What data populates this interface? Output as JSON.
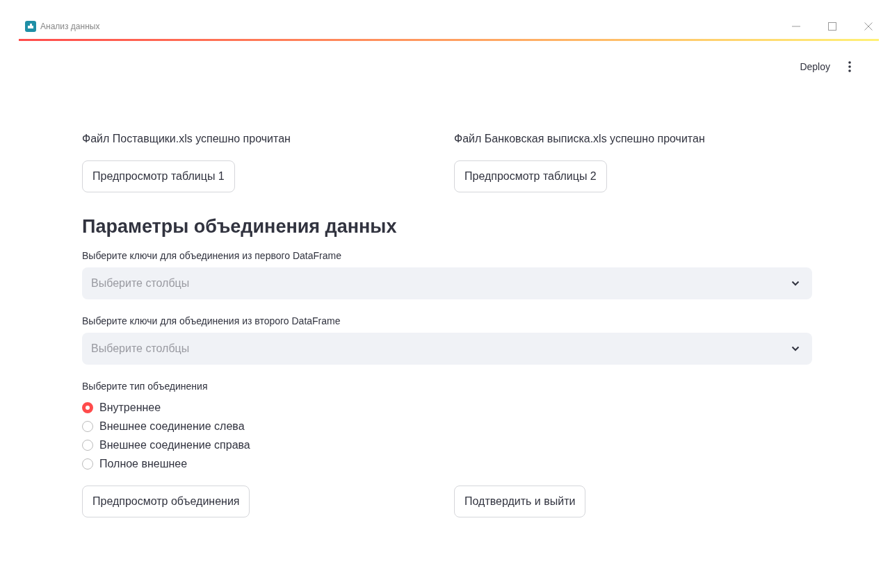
{
  "window": {
    "title": "Анализ данных"
  },
  "toolbar": {
    "deploy": "Deploy"
  },
  "files": [
    {
      "status": "Файл Поставщики.xls успешно прочитан",
      "button": "Предпросмотр таблицы 1"
    },
    {
      "status": "Файл Банковская выписка.xls успешно прочитан",
      "button": "Предпросмотр таблицы 2"
    }
  ],
  "heading": "Параметры объединения данных",
  "selects": [
    {
      "label": "Выберите ключи для объединения из первого DataFrame",
      "placeholder": "Выберите столбцы"
    },
    {
      "label": "Выберите ключи для объединения из второго DataFrame",
      "placeholder": "Выберите столбцы"
    }
  ],
  "join_type": {
    "label": "Выберите тип объединения",
    "options": [
      {
        "label": "Внутреннее",
        "selected": true
      },
      {
        "label": "Внешнее соединение слева",
        "selected": false
      },
      {
        "label": "Внешнее соединение справа",
        "selected": false
      },
      {
        "label": "Полное внешнее",
        "selected": false
      }
    ]
  },
  "actions": [
    "Предпросмотр объединения",
    "Подтвердить и выйти"
  ]
}
